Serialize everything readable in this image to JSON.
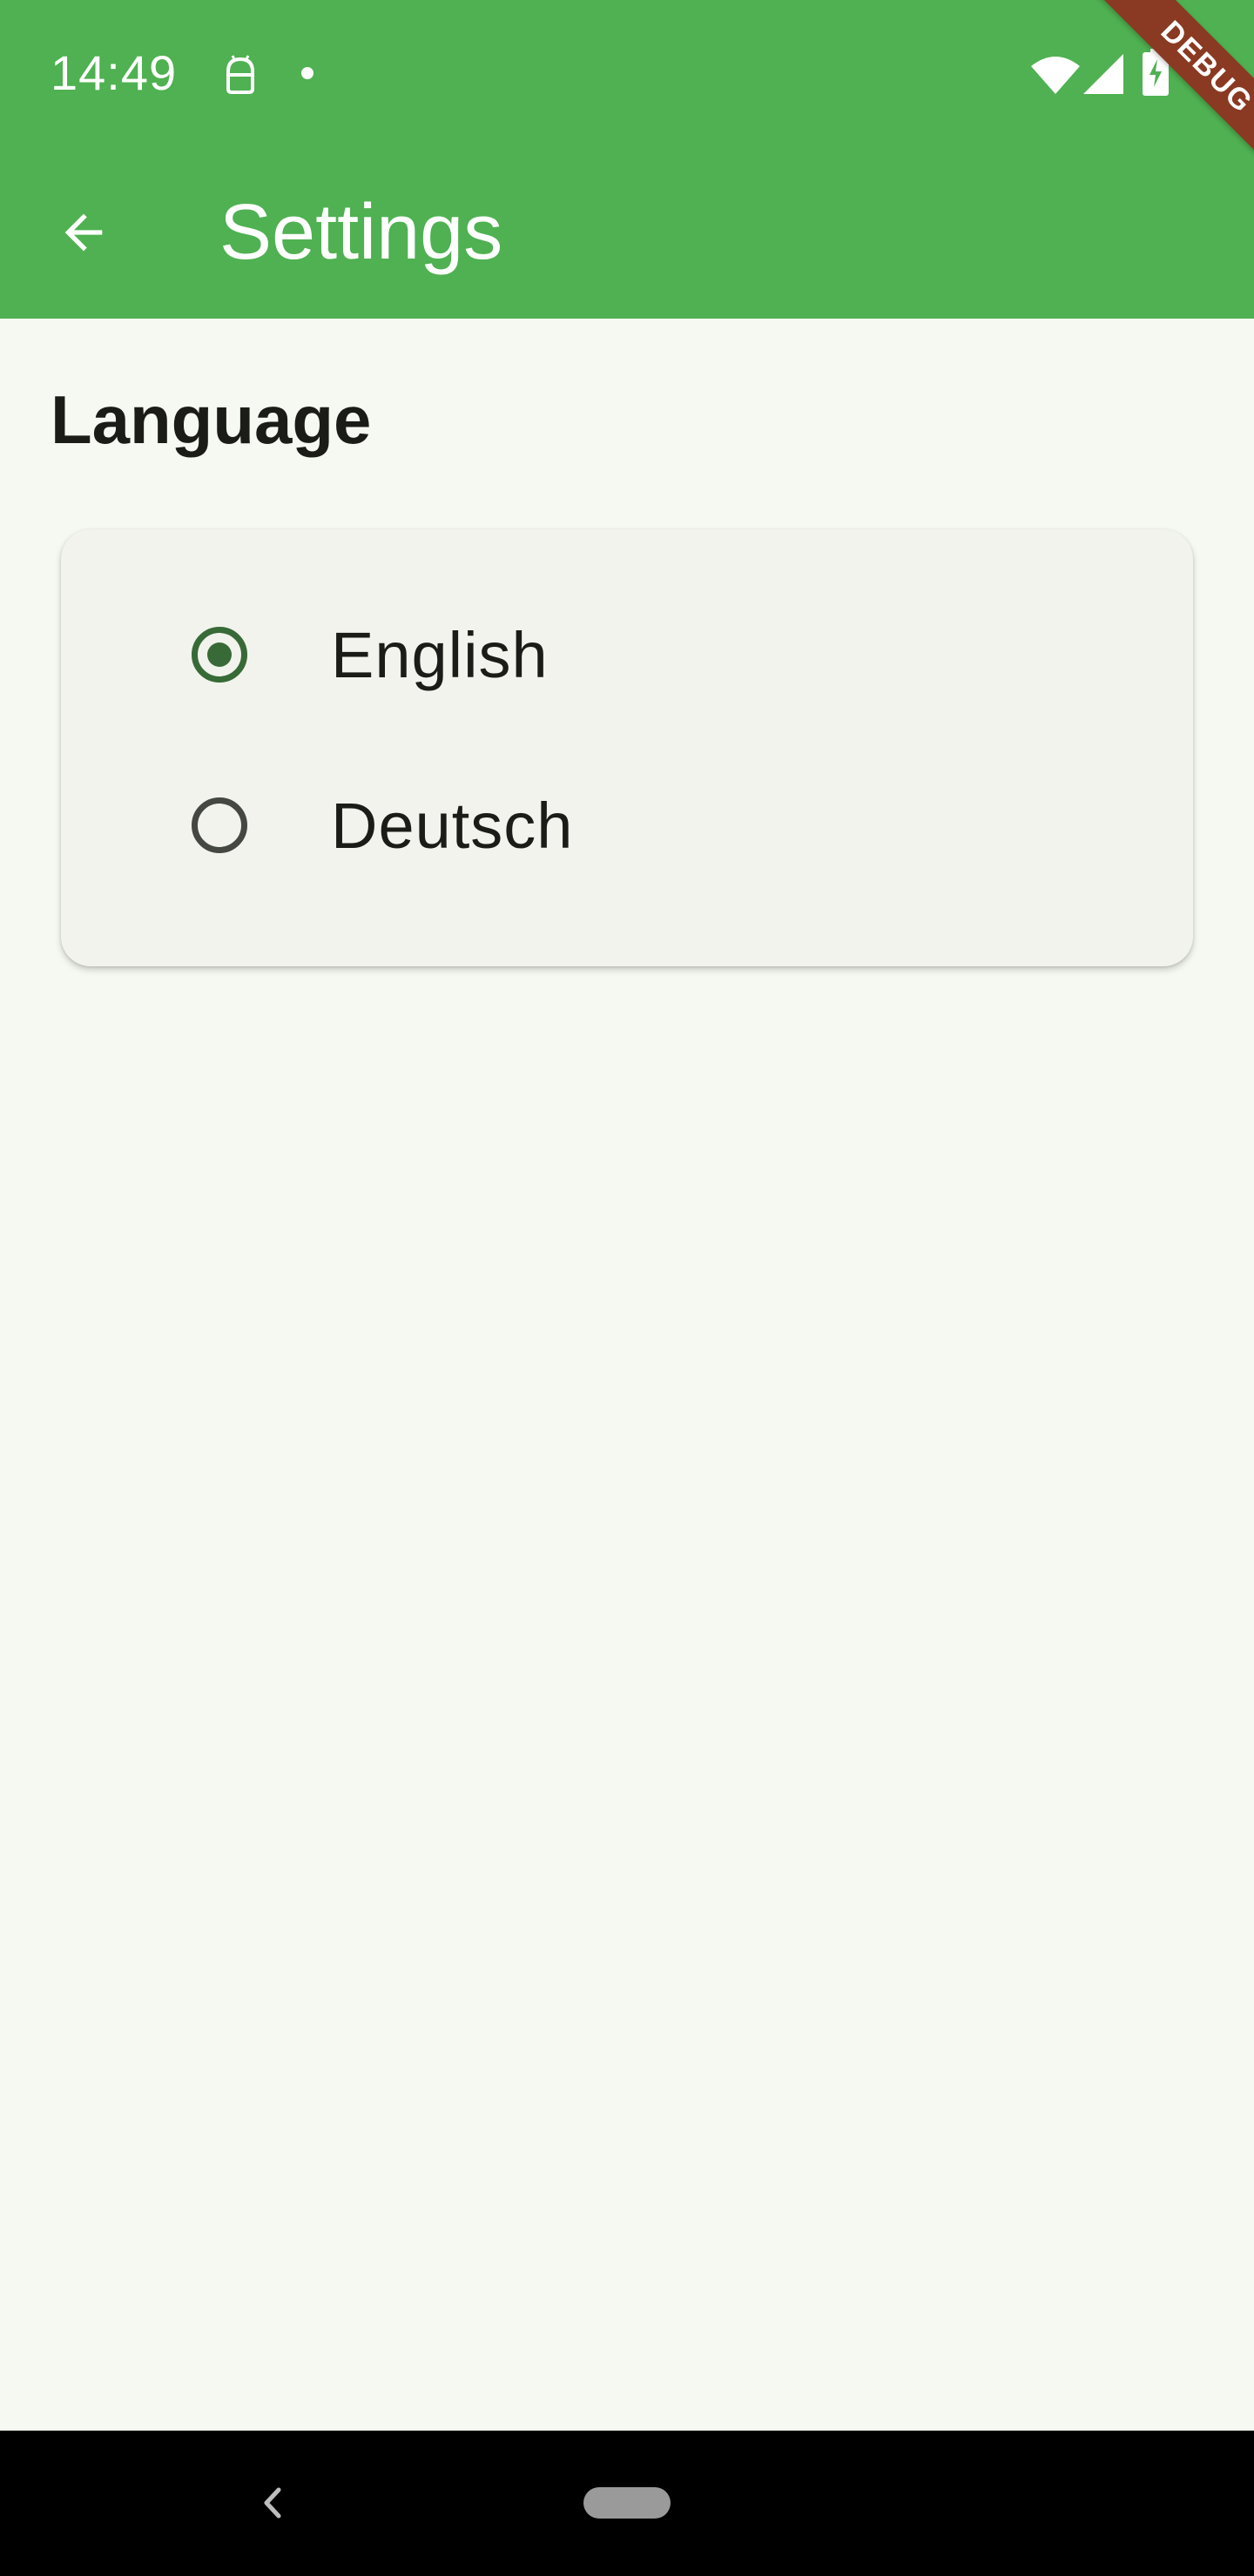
{
  "status_bar": {
    "time": "14:49",
    "icons": [
      "android-debug-icon",
      "notification-dot-icon",
      "wifi-icon",
      "cell-signal-icon",
      "battery-charging-icon"
    ]
  },
  "app_bar": {
    "back_icon": "arrow-back-icon",
    "title": "Settings",
    "color": "#4fb151"
  },
  "debug_banner": {
    "label": "DEBUG",
    "color": "#8a3a22"
  },
  "language_section": {
    "title": "Language",
    "options": [
      {
        "label": "English",
        "selected": true
      },
      {
        "label": "Deutsch",
        "selected": false
      }
    ],
    "accent_color": "#386a37"
  },
  "nav_bar": {
    "icons": [
      "nav-back-icon",
      "nav-home-pill"
    ]
  }
}
